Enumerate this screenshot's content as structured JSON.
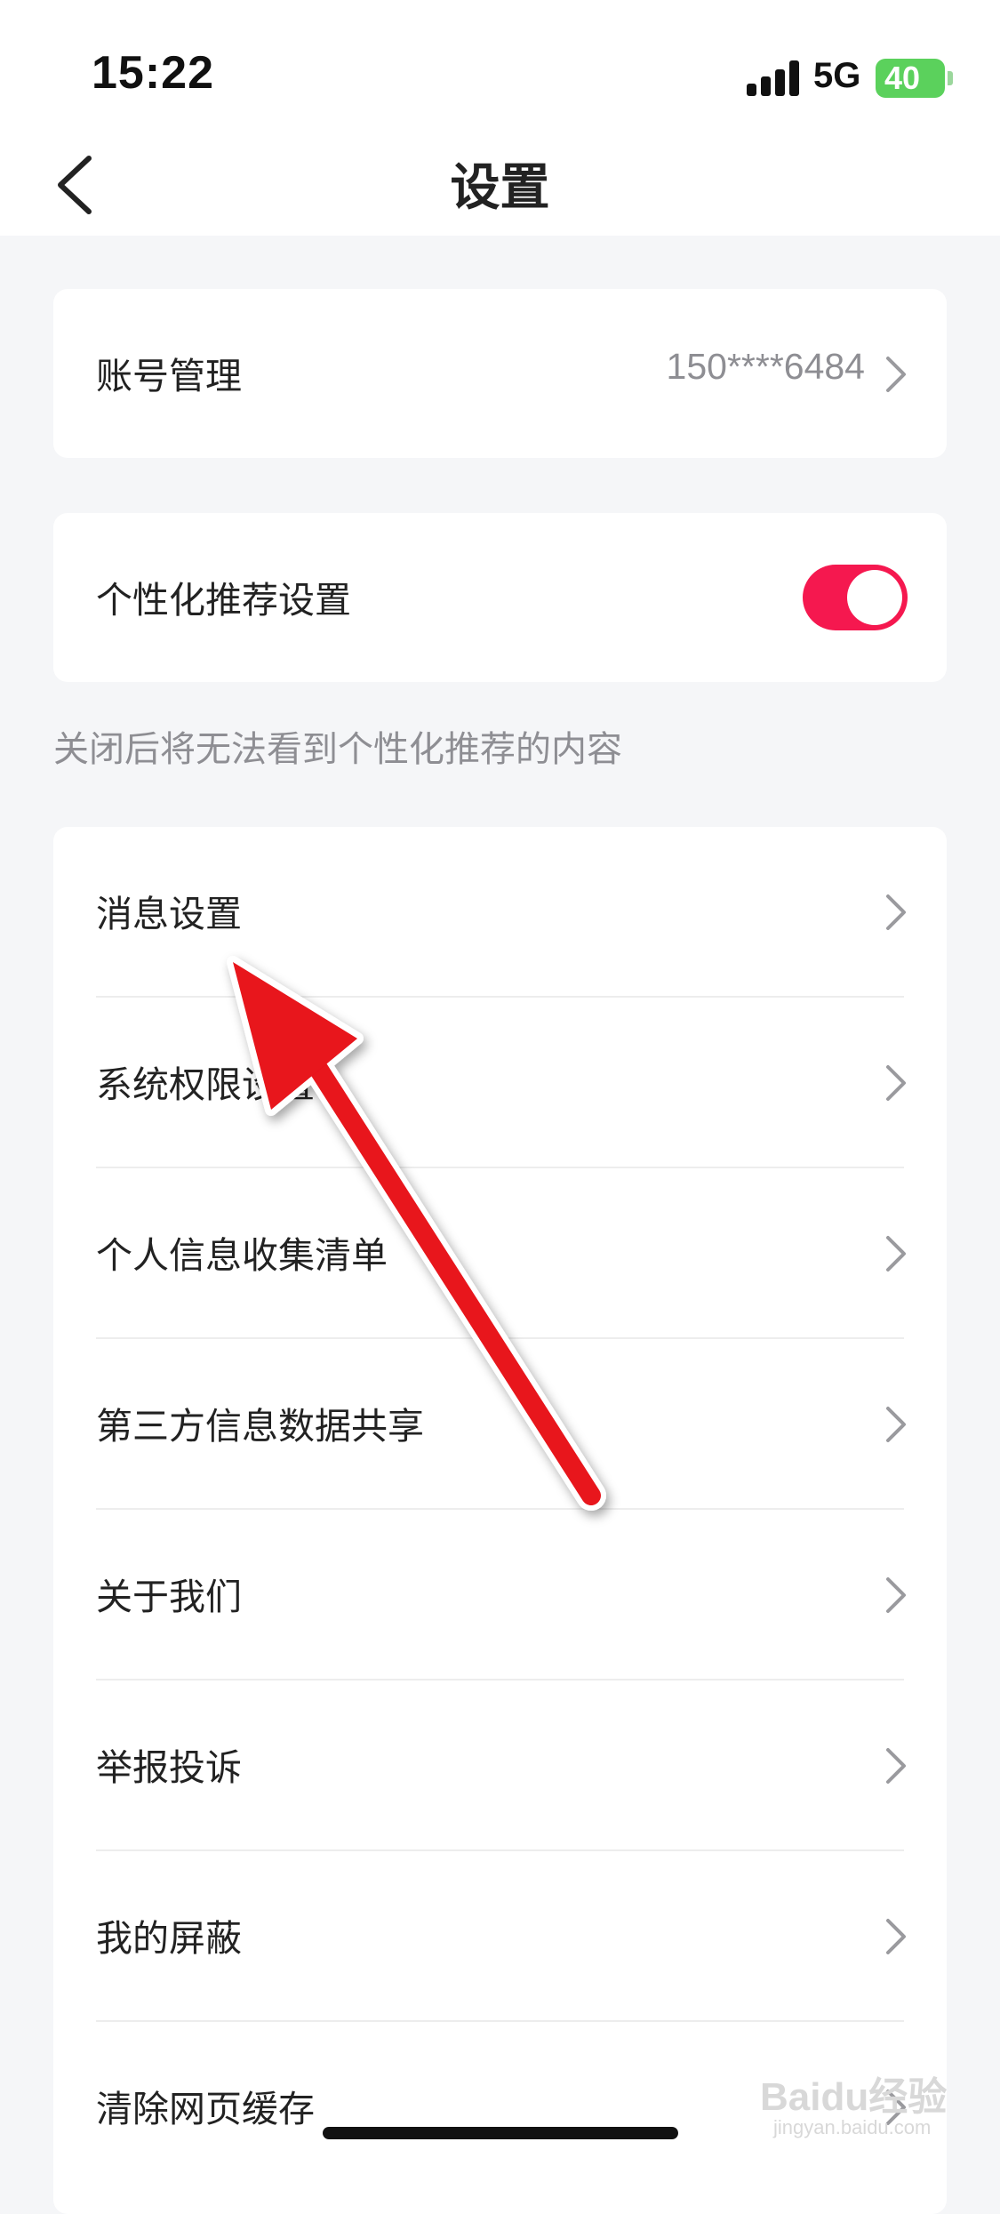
{
  "status_bar": {
    "time": "15:22",
    "network": "5G",
    "battery": "40"
  },
  "nav": {
    "title": "设置",
    "back_icon": "chevron-left-icon"
  },
  "account": {
    "label": "账号管理",
    "value": "150****6484"
  },
  "personalization": {
    "label": "个性化推荐设置",
    "enabled": true,
    "hint": "关闭后将无法看到个性化推荐的内容"
  },
  "menu": {
    "items": [
      {
        "label": "消息设置"
      },
      {
        "label": "系统权限设置"
      },
      {
        "label": "个人信息收集清单"
      },
      {
        "label": "第三方信息数据共享"
      },
      {
        "label": "关于我们"
      },
      {
        "label": "举报投诉"
      },
      {
        "label": "我的屏蔽"
      },
      {
        "label": "清除网页缓存"
      }
    ]
  },
  "watermark": {
    "text": "Baidu经验",
    "sub": "jingyan.baidu.com"
  },
  "colors": {
    "accent": "#F5184F",
    "annotation_arrow": "#E8121C",
    "battery": "#5BD15C"
  }
}
